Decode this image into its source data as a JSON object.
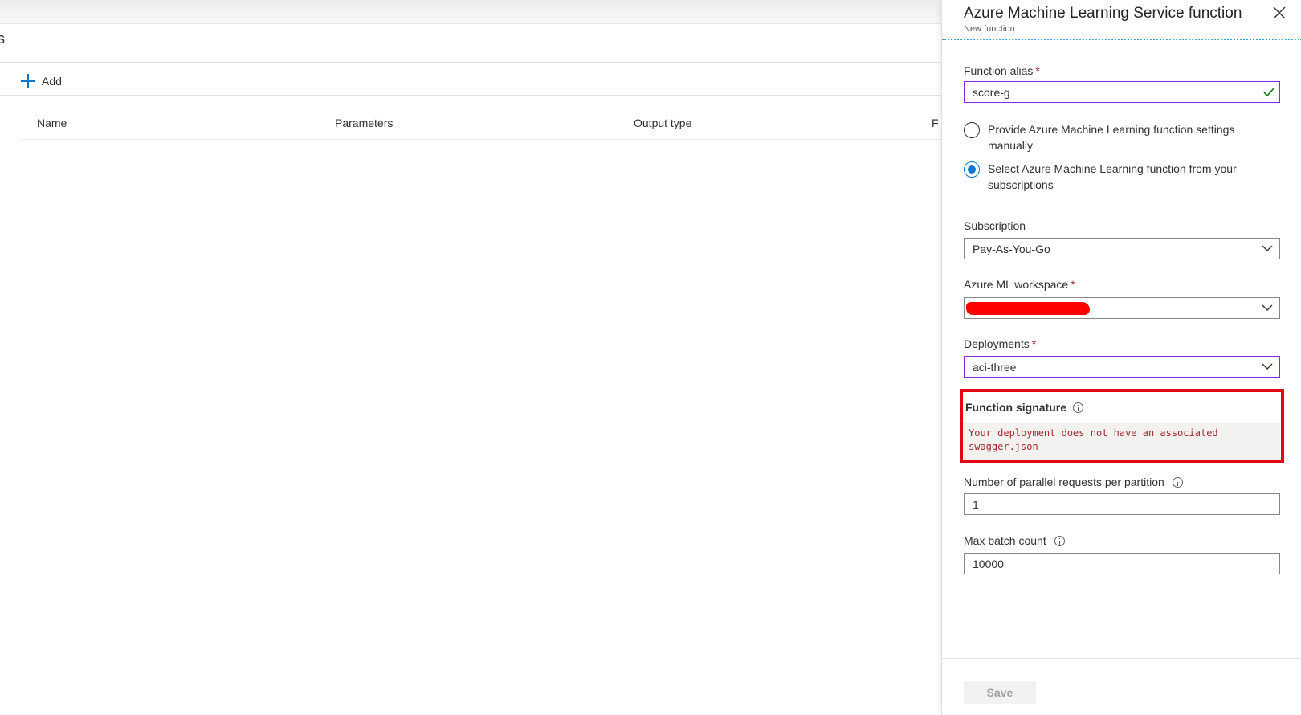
{
  "background": {
    "header_fragment": "s",
    "add_label": "Add",
    "columns": [
      "Name",
      "Parameters",
      "Output type",
      "F"
    ]
  },
  "blade": {
    "title": "Azure Machine Learning Service function",
    "subtitle": "New function",
    "function_alias": {
      "label": "Function alias",
      "required": "*",
      "value": "score-g"
    },
    "radio_options": [
      {
        "label": "Provide Azure Machine Learning function settings manually",
        "checked": false
      },
      {
        "label": "Select Azure Machine Learning function from your subscriptions",
        "checked": true
      }
    ],
    "subscription": {
      "label": "Subscription",
      "value": "Pay-As-You-Go"
    },
    "workspace": {
      "label": "Azure ML workspace",
      "required": "*",
      "value_redacted": true
    },
    "deployments": {
      "label": "Deployments",
      "required": "*",
      "value": "aci-three"
    },
    "function_signature": {
      "label": "Function signature",
      "message": "Your deployment does not have an associated swagger.json"
    },
    "parallel_requests": {
      "label": "Number of parallel requests per partition",
      "value": "1"
    },
    "max_batch": {
      "label": "Max batch count",
      "value": "10000"
    },
    "save_label": "Save"
  },
  "colors": {
    "accent": "#0078d4",
    "focus_border": "#8a2be2",
    "required": "#a4262c",
    "highlight_box": "#e30613",
    "success_check": "#107c10"
  }
}
